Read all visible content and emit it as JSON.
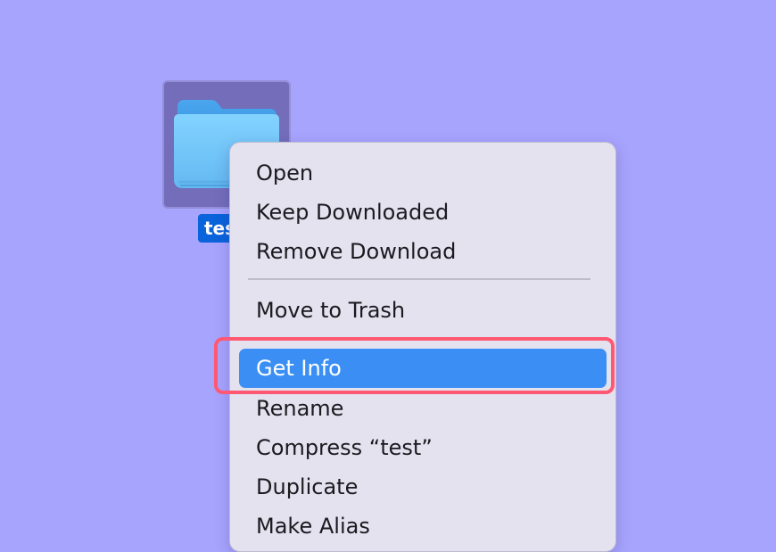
{
  "desktop": {
    "background_color": "#a7a4fe",
    "folder": {
      "label": "tes",
      "icon": "folder-icon"
    }
  },
  "context_menu": {
    "items": [
      {
        "label": "Open"
      },
      {
        "label": "Keep Downloaded"
      },
      {
        "label": "Remove Download"
      },
      {
        "label": "Move to Trash"
      },
      {
        "label": "Get Info",
        "selected": true
      },
      {
        "label": "Rename"
      },
      {
        "label": "Compress “test”"
      },
      {
        "label": "Duplicate"
      },
      {
        "label": "Make Alias"
      }
    ]
  },
  "highlight": {
    "color": "#ff5873"
  },
  "selection": {
    "color": "#3b8ff4"
  }
}
